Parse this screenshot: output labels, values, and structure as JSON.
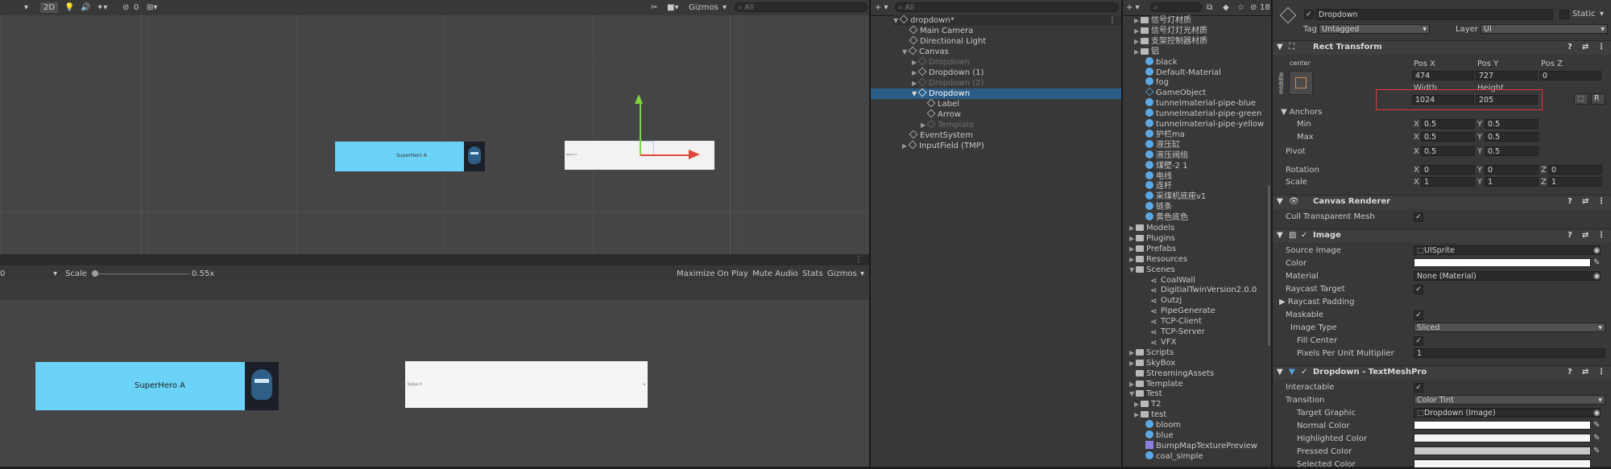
{
  "scene_toolbar": {
    "mode_2d": "2D",
    "hidden_count": "0",
    "gizmos": "Gizmos",
    "search_placeholder": "All"
  },
  "scene_view": {
    "button_text": "SuperHero A",
    "dropdown_text": "Option A"
  },
  "game_toolbar": {
    "display_value": "0",
    "scale_label": "Scale",
    "scale_value": "0.55x",
    "scale_level": 0.01,
    "maximize": "Maximize On Play",
    "mute": "Mute Audio",
    "stats": "Stats",
    "gizmos": "Gizmos"
  },
  "game_view": {
    "button_text": "SuperHero A",
    "dropdown_text": "Option A"
  },
  "hierarchy": {
    "search_placeholder": "All",
    "scene_name": "dropdown*",
    "items": [
      {
        "label": "Main Camera"
      },
      {
        "label": "Directional Light"
      },
      {
        "label": "Canvas"
      },
      {
        "label": "Dropdown"
      },
      {
        "label": "Dropdown (1)"
      },
      {
        "label": "Dropdown (2)"
      },
      {
        "label": "Dropdown"
      },
      {
        "label": "Label"
      },
      {
        "label": "Arrow"
      },
      {
        "label": "Template"
      },
      {
        "label": "EventSystem"
      },
      {
        "label": "InputField (TMP)"
      }
    ]
  },
  "project": {
    "search_placeholder": "",
    "hidden_count": "18",
    "assets": [
      "信号灯材质",
      "信号灯灯光材质",
      "支架控制器材质",
      "铝",
      "black",
      "Default-Material",
      "fog",
      "GameObject",
      "tunnelmaterial-pipe-blue",
      "tunnelmaterial-pipe-green",
      "tunnelmaterial-pipe-yellow",
      "护栏ma",
      "液压缸",
      "液压阀组",
      "煤壁-2 1",
      "电线",
      "连杆",
      "采煤机底座v1",
      "链条",
      "黄色底色"
    ],
    "folders": [
      "Models",
      "Plugins",
      "Prefabs",
      "Resources",
      "Scenes"
    ],
    "scenes": [
      "CoalWall",
      "DigitialTwinVersion2.0.0",
      "Outzj",
      "PipeGenerate",
      "TCP-Client",
      "TCP-Server",
      "VFX"
    ],
    "folders2": [
      "Scripts",
      "SkyBox",
      "StreamingAssets",
      "Template",
      "Test"
    ],
    "test_items": [
      "T2",
      "test",
      "bloom",
      "blue",
      "BumpMapTexturePreview",
      "coal_simple"
    ]
  },
  "inspector": {
    "object_name": "Dropdown",
    "static_label": "Static",
    "tag_label": "Tag",
    "tag_value": "Untagged",
    "layer_label": "Layer",
    "layer_value": "UI",
    "rect_transform": {
      "title": "Rect Transform",
      "anchor_h": "center",
      "anchor_v": "middle",
      "pos_x_label": "Pos X",
      "pos_y_label": "Pos Y",
      "pos_z_label": "Pos Z",
      "pos_x": "474",
      "pos_y": "727",
      "pos_z": "0",
      "width_label": "Width",
      "height_label": "Height",
      "width": "1024",
      "height": "205",
      "anchors_label": "Anchors",
      "min_label": "Min",
      "max_label": "Max",
      "min_x": "0.5",
      "min_y": "0.5",
      "max_x": "0.5",
      "max_y": "0.5",
      "pivot_label": "Pivot",
      "pivot_x": "0.5",
      "pivot_y": "0.5",
      "rotation_label": "Rotation",
      "rot_x": "0",
      "rot_y": "0",
      "rot_z": "0",
      "scale_label": "Scale",
      "scale_x": "1",
      "scale_y": "1",
      "scale_z": "1",
      "raw_btn": "R"
    },
    "canvas_renderer": {
      "title": "Canvas Renderer",
      "cull_label": "Cull Transparent Mesh"
    },
    "image": {
      "title": "Image",
      "source_label": "Source Image",
      "source_value": "UISprite",
      "color_label": "Color",
      "material_label": "Material",
      "material_value": "None (Material)",
      "raycast_label": "Raycast Target",
      "padding_label": "Raycast Padding",
      "maskable_label": "Maskable",
      "type_label": "Image Type",
      "type_value": "Sliced",
      "fill_label": "Fill Center",
      "ppu_label": "Pixels Per Unit Multiplier",
      "ppu_value": "1"
    },
    "dropdown": {
      "title": "Dropdown - TextMeshPro",
      "interactable_label": "Interactable",
      "transition_label": "Transition",
      "transition_value": "Color Tint",
      "target_label": "Target Graphic",
      "target_value": "Dropdown (Image)",
      "normal_label": "Normal Color",
      "highlighted_label": "Highlighted Color",
      "pressed_label": "Pressed Color",
      "selected_label": "Selected Color"
    }
  },
  "colors": {
    "highlight_box": "#e53935",
    "game_button": "#6ad3f7",
    "selection": "#2c5d87"
  }
}
